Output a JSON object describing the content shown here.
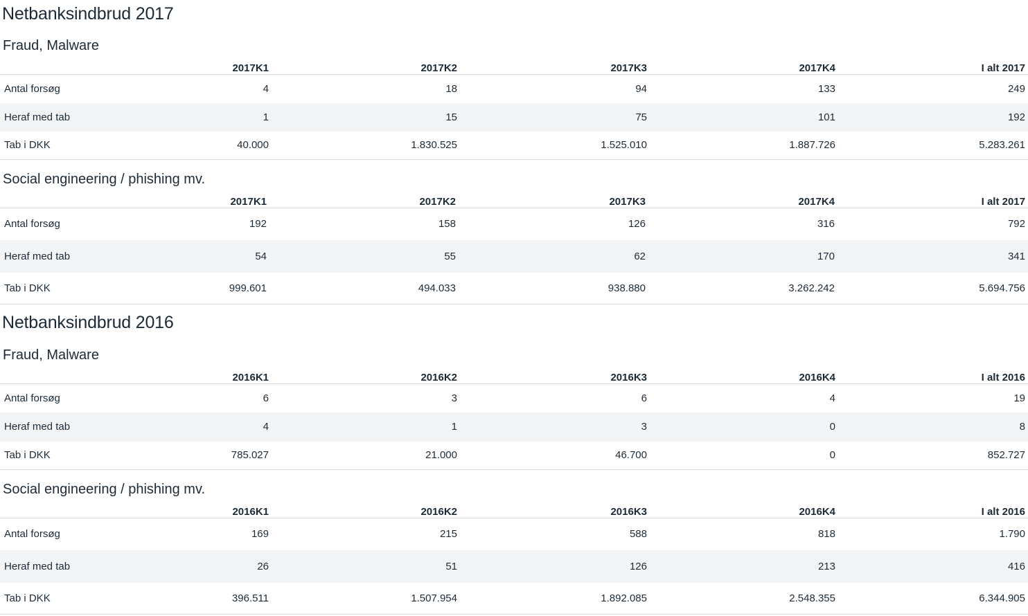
{
  "sections": [
    {
      "title": "Netbanksindbrud 2017",
      "tables": [
        {
          "title": "Fraud, Malware",
          "headers": [
            "2017K1",
            "2017K2",
            "2017K3",
            "2017K4",
            "I alt 2017"
          ],
          "rows": [
            {
              "label": "Antal forsøg",
              "values": [
                "4",
                "18",
                "94",
                "133",
                "249"
              ]
            },
            {
              "label": "Heraf med tab",
              "values": [
                "1",
                "15",
                "75",
                "101",
                "192"
              ]
            },
            {
              "label": "Tab i DKK",
              "values": [
                "40.000",
                "1.830.525",
                "1.525.010",
                "1.887.726",
                "5.283.261"
              ]
            }
          ]
        },
        {
          "title": "Social engineering / phishing mv.",
          "headers": [
            "2017K1",
            "2017K2",
            "2017K3",
            "2017K4",
            "I alt 2017"
          ],
          "rows": [
            {
              "label": "Antal forsøg",
              "values": [
                "192",
                "158",
                "126",
                "316",
                "792"
              ]
            },
            {
              "label": "Heraf med tab",
              "values": [
                "54",
                "55",
                "62",
                "170",
                "341"
              ]
            },
            {
              "label": "Tab i DKK",
              "values": [
                "999.601",
                "494.033",
                "938.880",
                "3.262.242",
                "5.694.756"
              ]
            }
          ]
        }
      ]
    },
    {
      "title": "Netbanksindbrud 2016",
      "tables": [
        {
          "title": "Fraud, Malware",
          "headers": [
            "2016K1",
            "2016K2",
            "2016K3",
            "2016K4",
            "I alt 2016"
          ],
          "rows": [
            {
              "label": "Antal forsøg",
              "values": [
                "6",
                "3",
                "6",
                "4",
                "19"
              ]
            },
            {
              "label": "Heraf med tab",
              "values": [
                "4",
                "1",
                "3",
                "0",
                "8"
              ]
            },
            {
              "label": "Tab i DKK",
              "values": [
                "785.027",
                "21.000",
                "46.700",
                "0",
                "852.727"
              ]
            }
          ]
        },
        {
          "title": "Social engineering / phishing mv.",
          "headers": [
            "2016K1",
            "2016K2",
            "2016K3",
            "2016K4",
            "I alt 2016"
          ],
          "rows": [
            {
              "label": "Antal forsøg",
              "values": [
                "169",
                "215",
                "588",
                "818",
                "1.790"
              ]
            },
            {
              "label": "Heraf med tab",
              "values": [
                "26",
                "51",
                "126",
                "213",
                "416"
              ]
            },
            {
              "label": "Tab i DKK",
              "values": [
                "396.511",
                "1.507.954",
                "1.892.085",
                "2.548.355",
                "6.344.905"
              ]
            }
          ]
        }
      ]
    }
  ]
}
